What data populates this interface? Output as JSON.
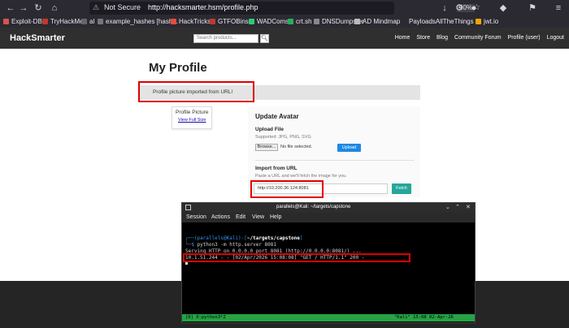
{
  "browser": {
    "not_secure": "Not Secure",
    "url": "http://hacksmarter.hsm/profile.php",
    "zoom": "90%",
    "bookmarks": [
      "Exploit-DB",
      "TryHackMe",
      "al",
      "example_hashes [hash...",
      "HackTricks",
      "GTFOBins",
      "WADComs",
      "crt.sh",
      "DNSDumpster",
      "AD Mindmap",
      "PayloadsAllTheThings",
      "jwt.io"
    ]
  },
  "site": {
    "brand": "HackSmarter",
    "search_placeholder": "Search products...",
    "nav": [
      "Home",
      "Store",
      "Blog",
      "Community Forum",
      "Profile (user)",
      "Logout"
    ]
  },
  "profile": {
    "title": "My Profile",
    "notice": "Profile picture imported from URL!",
    "picture_title": "Profile Picture",
    "view_full_size": "View Full Size"
  },
  "avatar": {
    "heading": "Update Avatar",
    "upload_heading": "Upload File",
    "supported": "Supported: JPG, PNG, SVG",
    "browse": "Browse...",
    "no_file": "No file selected.",
    "upload_button": "Upload",
    "import_heading": "Import from URL",
    "paste_hint": "Paste a URL and we'll fetch the image for you.",
    "url_value": "http://10.200.36.124:8081",
    "fetch_button": "Fetch"
  },
  "terminal": {
    "title": "parallels@Kali: ~/targets/capstone",
    "menu": [
      "Session",
      "Actions",
      "Edit",
      "View",
      "Help"
    ],
    "prompt_user": "(parallels@Kali)",
    "prompt_path": "~/targets/capstone",
    "command": "python3 -m http.server 8081",
    "serving": "Serving HTTP on 0.0.0.0 port 8081 (http://0.0.0.0:8081/) ...",
    "log": "10.1.51.244 - - [02/Apr/2026 15:08:08] \"GET / HTTP/1.1\" 200 -",
    "status_left": "[0] 0:python3*Z",
    "status_right": "\"Kali\" 15:08 02-Apr-26"
  }
}
